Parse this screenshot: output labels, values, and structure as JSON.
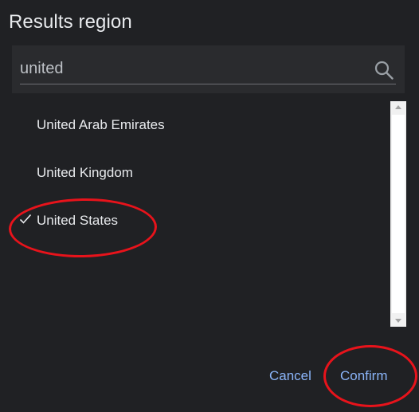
{
  "dialog": {
    "title": "Results region"
  },
  "search": {
    "value": "united",
    "icon": "search-icon"
  },
  "list": {
    "items": [
      {
        "label": "United Arab Emirates",
        "selected": false
      },
      {
        "label": "United Kingdom",
        "selected": false
      },
      {
        "label": "United States",
        "selected": true
      }
    ]
  },
  "buttons": {
    "cancel_label": "Cancel",
    "confirm_label": "Confirm"
  },
  "colors": {
    "background": "#202124",
    "accent": "#8ab4f8",
    "annotation": "#e8131b"
  }
}
